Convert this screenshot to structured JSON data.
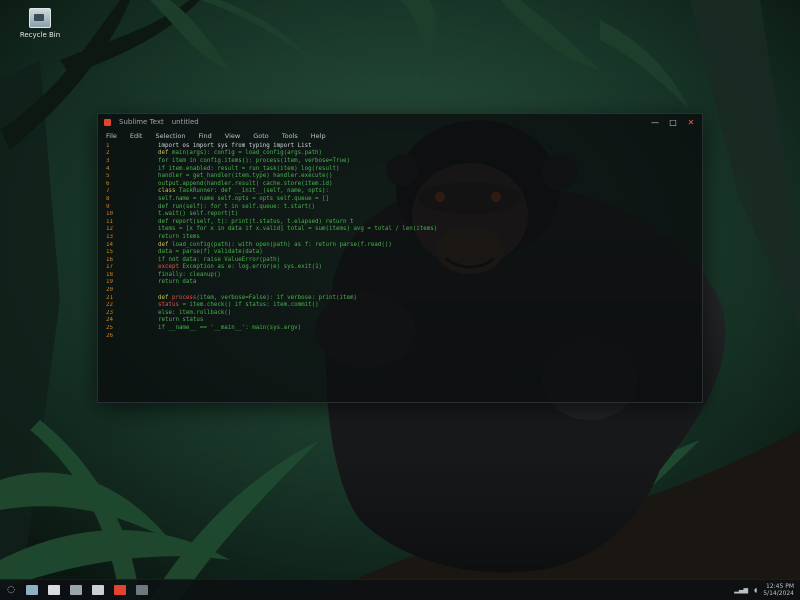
{
  "colors": {
    "accent_red": "#e44332",
    "code_green": "#49b24e",
    "line_number_orange": "#d18a2c"
  },
  "desktop": {
    "icon": {
      "label": "Recycle Bin",
      "icon_name": "recycle-bin-icon"
    }
  },
  "window": {
    "title": "Sublime Text",
    "document": "untitled",
    "menu": [
      "File",
      "Edit",
      "Selection",
      "Find",
      "View",
      "Goto",
      "Tools",
      "Help"
    ],
    "controls": {
      "minimize": "—",
      "maximize": "□",
      "close": "✕"
    }
  },
  "editor": {
    "lines": [
      {
        "n": "1",
        "parts": [
          [
            "w",
            "                             import os  import sys  from typing import List"
          ]
        ]
      },
      {
        "n": "2",
        "parts": [
          [
            "k",
            "    def "
          ],
          [
            "c",
            "main(args):  config = load_config(args.path)"
          ]
        ]
      },
      {
        "n": "3",
        "parts": [
          [
            "c",
            "      for item in config.items():  process(item, verbose=True)"
          ]
        ]
      },
      {
        "n": "4",
        "parts": [
          [
            "c",
            "        if item.enabled:  result = run_task(item)  log(result)"
          ]
        ]
      },
      {
        "n": "5",
        "parts": [
          [
            "c",
            "          handler = get_handler(item.type)  handler.execute()"
          ]
        ]
      },
      {
        "n": "6",
        "parts": [
          [
            "c",
            "          output.append(handler.result)  cache.store(item.id)"
          ]
        ]
      },
      {
        "n": "7",
        "parts": [
          [
            "k",
            "    class "
          ],
          [
            "c",
            "TaskRunner:  def __init__(self, name, opts):"
          ]
        ]
      },
      {
        "n": "8",
        "parts": [
          [
            "c",
            "      self.name = name  self.opts = opts  self.queue = []"
          ]
        ]
      },
      {
        "n": "9",
        "parts": [
          [
            "c",
            "      def run(self):  for t in self.queue:  t.start()"
          ]
        ]
      },
      {
        "n": "10",
        "parts": [
          [
            "c",
            "        t.wait()  self.report(t)"
          ]
        ]
      },
      {
        "n": "11",
        "parts": [
          [
            "c",
            "      def report(self, t):  print(t.status, t.elapsed)  return t"
          ]
        ]
      },
      {
        "n": "12",
        "parts": [
          [
            "c",
            "    items = [x for x in data if x.valid]  total = sum(items)  avg = total / len(items)"
          ]
        ]
      },
      {
        "n": "13",
        "parts": [
          [
            "c",
            "    return items"
          ]
        ]
      },
      {
        "n": "14",
        "parts": [
          [
            "k",
            "    def "
          ],
          [
            "c",
            "load_config(path):  with open(path) as f:  return parse(f.read())"
          ]
        ]
      },
      {
        "n": "15",
        "parts": [
          [
            "c",
            "      data = parse(f)  validate(data)"
          ]
        ]
      },
      {
        "n": "16",
        "parts": [
          [
            "c",
            "        if not data:  raise ValueError(path)"
          ]
        ]
      },
      {
        "n": "17",
        "parts": [
          [
            "r",
            "          except"
          ],
          [
            "c",
            " Exception as e:  log.error(e)  sys.exit(1)"
          ]
        ]
      },
      {
        "n": "18",
        "parts": [
          [
            "c",
            "          finally:  cleanup()"
          ]
        ]
      },
      {
        "n": "19",
        "parts": [
          [
            "c",
            "      return data"
          ]
        ]
      },
      {
        "n": "20",
        "parts": [
          [
            "c",
            "    "
          ]
        ]
      },
      {
        "n": "21",
        "parts": [
          [
            "k",
            "    def "
          ],
          [
            "r",
            "process"
          ],
          [
            "c",
            "(item, verbose=False):  if verbose:  print(item)"
          ]
        ]
      },
      {
        "n": "22",
        "parts": [
          [
            "r",
            "      status"
          ],
          [
            "c",
            " = item.check()  if status:  item.commit()"
          ]
        ]
      },
      {
        "n": "23",
        "parts": [
          [
            "c",
            "      else:  item.rollback()"
          ]
        ]
      },
      {
        "n": "24",
        "parts": [
          [
            "c",
            "      return status"
          ]
        ]
      },
      {
        "n": "25",
        "parts": [
          [
            "c",
            "    if __name__ == '__main__':  main(sys.argv)"
          ]
        ]
      },
      {
        "n": "26",
        "parts": [
          [
            "c",
            "    "
          ]
        ]
      }
    ]
  },
  "taskbar": {
    "start_icon": "start-icon",
    "pinned": [
      "file-explorer-icon",
      "browser-icon",
      "mail-icon",
      "photos-icon",
      "editor-icon",
      "terminal-icon"
    ],
    "tray_time": "12:45 PM",
    "tray_date": "5/14/2024"
  }
}
